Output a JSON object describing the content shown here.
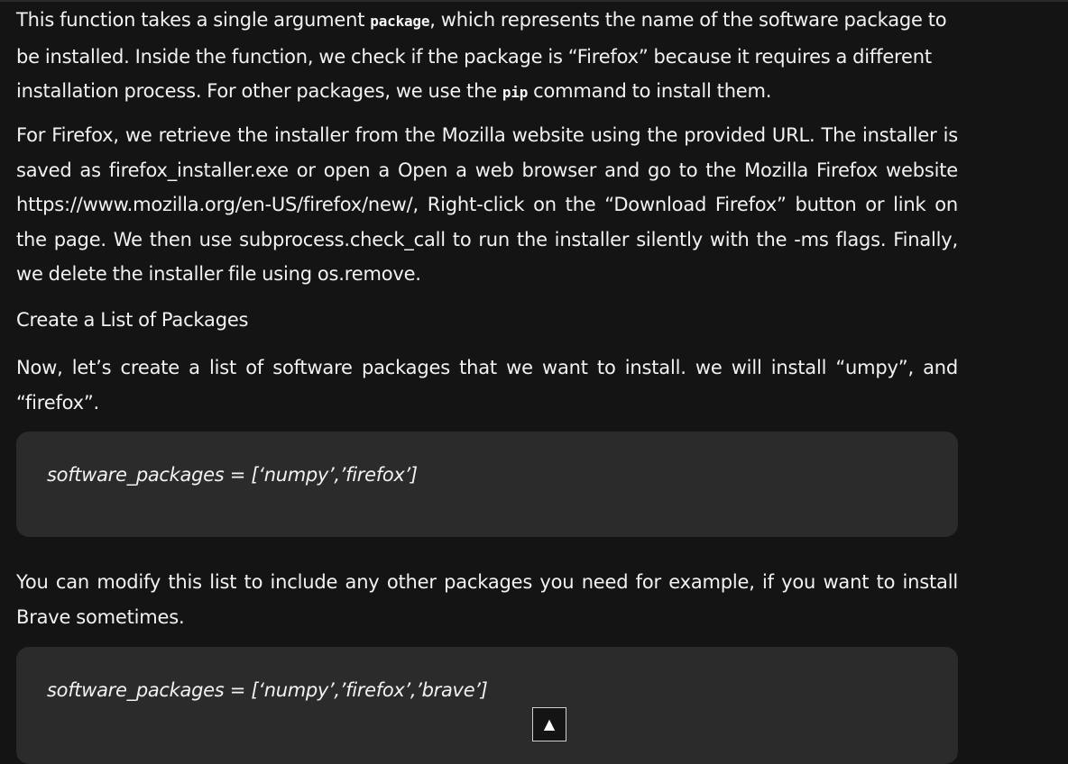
{
  "article": {
    "para1": {
      "before_code1": "This function takes a single argument ",
      "code1": "package",
      "after_code1": ", which represents the name of the software package to be installed. Inside the function, we check if the package is “Firefox” because it requires a different installation process. For other packages, we use the ",
      "code2": "pip",
      "after_code2": " command to install them."
    },
    "para2": "For Firefox, we retrieve the installer from the Mozilla website using the provided URL. The installer is saved as firefox_installer.exe or open a Open a web browser and go to the Mozilla Firefox website https://www.mozilla.org/en-US/firefox/new/, Right-click on the “Download Firefox” button or link on the page. We then use subprocess.check_call to run the installer silently with the -ms flags. Finally, we delete the installer file using os.remove.",
    "heading": "Create a List of Packages",
    "para3": "Now, let’s create a list of software packages that we want to install. we will install “umpy”, and “firefox”.",
    "code_block1": "software_packages = [‘numpy’,’firefox’]",
    "para4": "You can modify this list to include any other packages you need for example, if you want to install Brave sometimes.",
    "code_block2": "software_packages = [‘numpy’,’firefox’,’brave’]"
  },
  "scroll_top": {
    "label": "▲"
  },
  "colors": {
    "background": "#141414",
    "text": "#f2f2f2",
    "code_block_bg": "#2b2b2b"
  }
}
